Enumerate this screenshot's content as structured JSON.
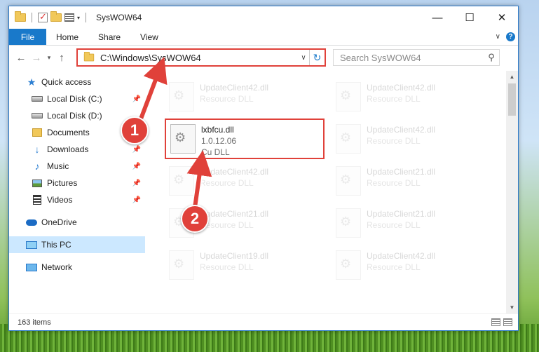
{
  "window": {
    "title": "SysWOW64"
  },
  "ribbon": {
    "tabs": [
      "File",
      "Home",
      "Share",
      "View"
    ],
    "help": "?"
  },
  "address": {
    "path": "C:\\Windows\\SysWOW64",
    "search_placeholder": "Search SysWOW64"
  },
  "sidebar": {
    "items": [
      {
        "label": "Quick access"
      },
      {
        "label": "Local Disk (C:)"
      },
      {
        "label": "Local Disk (D:)"
      },
      {
        "label": "Documents"
      },
      {
        "label": "Downloads"
      },
      {
        "label": "Music"
      },
      {
        "label": "Pictures"
      },
      {
        "label": "Videos"
      },
      {
        "label": "OneDrive"
      },
      {
        "label": "This PC"
      },
      {
        "label": "Network"
      }
    ]
  },
  "files": [
    {
      "name": "UpdateClient42.dll",
      "type": "Resource DLL"
    },
    {
      "name": "UpdateClient42.dll",
      "type": "Resource DLL"
    },
    {
      "name": "lxbfcu.dll",
      "version": "1.0.12.06",
      "type": "Cu DLL"
    },
    {
      "name": "UpdateClient42.dll",
      "type": "Resource DLL"
    },
    {
      "name": "UpdateClient42.dll",
      "type": "Resource DLL"
    },
    {
      "name": "UpdateClient21.dll",
      "type": "Resource DLL"
    },
    {
      "name": "UpdateClient21.dll",
      "type": "Resource DLL"
    },
    {
      "name": "UpdateClient21.dll",
      "type": "Resource DLL"
    },
    {
      "name": "UpdateClient19.dll",
      "type": "Resource DLL"
    },
    {
      "name": "UpdateClient42.dll",
      "type": "Resource DLL"
    }
  ],
  "status": {
    "items_count": "163 items"
  },
  "markers": [
    "1",
    "2"
  ],
  "colors": {
    "accent": "#1979ca",
    "highlight": "#e0413a",
    "selected": "#cce8ff"
  }
}
